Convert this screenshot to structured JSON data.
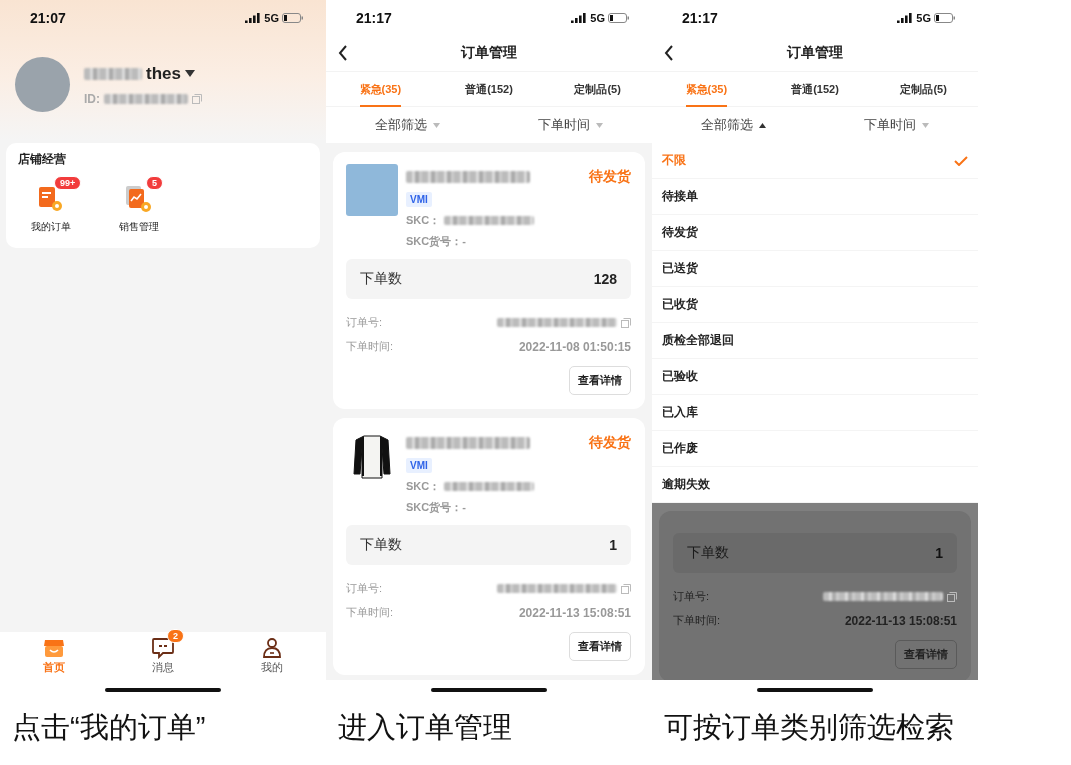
{
  "screens": [
    {
      "kind": "home",
      "status_bar": {
        "time": "21:07",
        "network": "5G"
      },
      "profile": {
        "name": "thes",
        "id_label": "ID:"
      },
      "shop_section": {
        "title": "店铺经营",
        "shortcuts": [
          {
            "kind": "orders",
            "label": "我的订单",
            "badge": "99+"
          },
          {
            "kind": "sales",
            "label": "销售管理",
            "badge": "5"
          }
        ]
      },
      "tab_bar": [
        {
          "kind": "home",
          "label": "首页",
          "selected": true
        },
        {
          "kind": "messages",
          "label": "消息",
          "badge": "2",
          "selected": false
        },
        {
          "kind": "profile",
          "label": "我的",
          "selected": false
        }
      ],
      "caption": "点击“我的订单”"
    },
    {
      "kind": "orders",
      "status_bar": {
        "time": "21:17",
        "network": "5G"
      },
      "title": "订单管理",
      "tabs": [
        {
          "label": "紧急(35)",
          "selected": true
        },
        {
          "label": "普通(152)",
          "selected": false
        },
        {
          "label": "定制品(5)",
          "selected": false
        }
      ],
      "filters": [
        {
          "label": "全部筛选",
          "open": false
        },
        {
          "label": "下单时间",
          "open": false
        }
      ],
      "orders": [
        {
          "kind": "photo",
          "status": "待发货",
          "tag": "VMI",
          "skc_label": "SKC：",
          "skc_code": "SKC货号：-",
          "qty_label": "下单数",
          "qty": "128",
          "order_no_label": "订单号:",
          "time_label": "下单时间:",
          "time": "2022-11-08 01:50:15",
          "button": "查看详情"
        },
        {
          "kind": "garment",
          "status": "待发货",
          "tag": "VMI",
          "skc_label": "SKC：",
          "skc_code": "SKC货号：-",
          "qty_label": "下单数",
          "qty": "1",
          "order_no_label": "订单号:",
          "time_label": "下单时间:",
          "time": "2022-11-13 15:08:51",
          "button": "查看详情"
        }
      ],
      "caption": "进入订单管理"
    },
    {
      "kind": "filter",
      "status_bar": {
        "time": "21:17",
        "network": "5G"
      },
      "title": "订单管理",
      "tabs": [
        {
          "label": "紧急(35)",
          "selected": true
        },
        {
          "label": "普通(152)",
          "selected": false
        },
        {
          "label": "定制品(5)",
          "selected": false
        }
      ],
      "filters": [
        {
          "label": "全部筛选",
          "open": true
        },
        {
          "label": "下单时间",
          "open": false
        }
      ],
      "options": [
        {
          "label": "不限",
          "selected": true
        },
        {
          "label": "待接单",
          "selected": false
        },
        {
          "label": "待发货",
          "selected": false
        },
        {
          "label": "已送货",
          "selected": false
        },
        {
          "label": "已收货",
          "selected": false
        },
        {
          "label": "质检全部退回",
          "selected": false
        },
        {
          "label": "已验收",
          "selected": false
        },
        {
          "label": "已入库",
          "selected": false
        },
        {
          "label": "已作废",
          "selected": false
        },
        {
          "label": "逾期失效",
          "selected": false
        }
      ],
      "dimmed_order": {
        "qty_label": "下单数",
        "qty": "1",
        "order_no_label": "订单号:",
        "time_label": "下单时间:",
        "time": "2022-11-13 15:08:51",
        "button": "查看详情"
      },
      "caption": "可按订单类别筛选检索"
    }
  ]
}
